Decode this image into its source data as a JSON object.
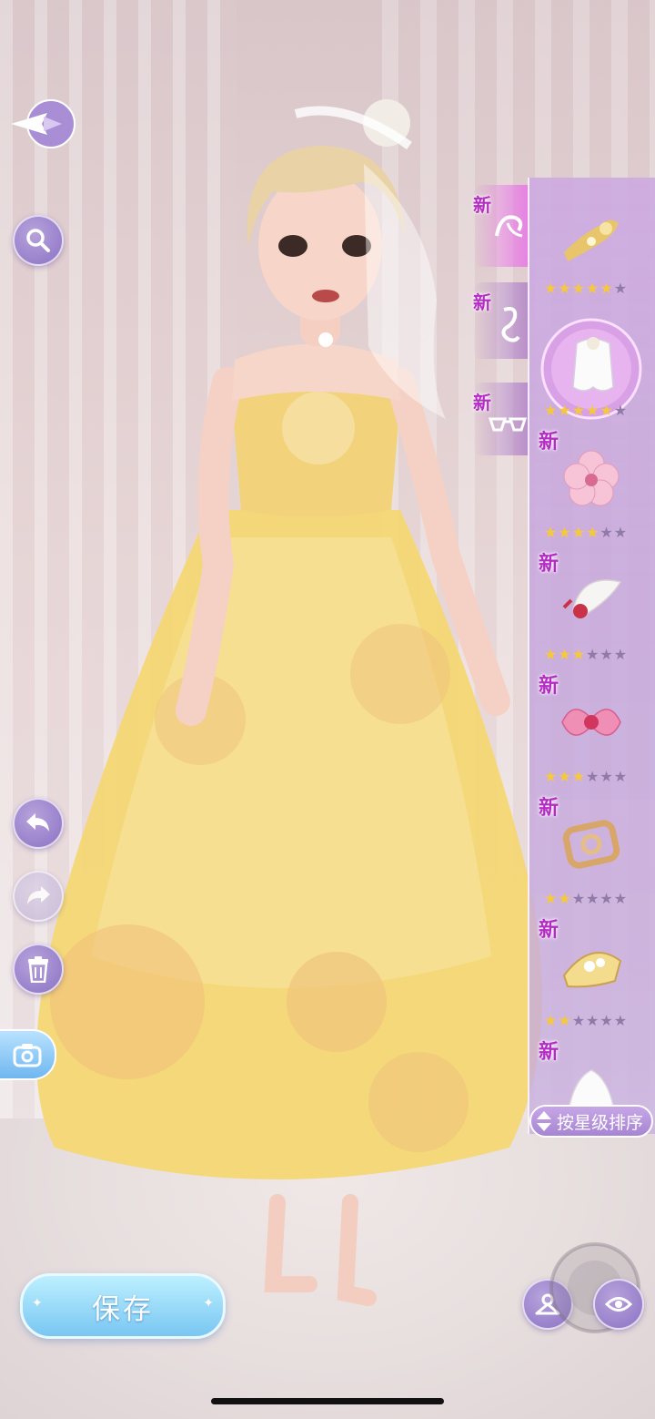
{
  "left_toolbar": {
    "back": "back-icon",
    "search": "search-icon",
    "undo": "undo-icon",
    "redo": "redo-icon",
    "delete": "trash-icon",
    "camera": "camera-icon"
  },
  "save_button": {
    "label": "保存"
  },
  "category_tabs": [
    {
      "new_label": "新",
      "icon": "hair-accessory-icon",
      "active": true
    },
    {
      "new_label": "新",
      "icon": "earring-icon",
      "active": false
    },
    {
      "new_label": "新",
      "icon": "glasses-icon",
      "active": false
    }
  ],
  "items": [
    {
      "new_label": "",
      "name_icon": "gold-hairpin",
      "stars": 5,
      "max_stars": 6,
      "selected": false
    },
    {
      "new_label": "",
      "name_icon": "white-veil",
      "stars": 5,
      "max_stars": 6,
      "selected": true
    },
    {
      "new_label": "新",
      "name_icon": "pink-flower",
      "stars": 4,
      "max_stars": 6,
      "selected": false
    },
    {
      "new_label": "新",
      "name_icon": "white-feather-clip",
      "stars": 3,
      "max_stars": 6,
      "selected": false
    },
    {
      "new_label": "新",
      "name_icon": "pink-bow",
      "stars": 3,
      "max_stars": 6,
      "selected": false
    },
    {
      "new_label": "新",
      "name_icon": "gold-ornament",
      "stars": 2,
      "max_stars": 6,
      "selected": false
    },
    {
      "new_label": "新",
      "name_icon": "gold-fan-clip",
      "stars": 2,
      "max_stars": 6,
      "selected": false
    },
    {
      "new_label": "新",
      "name_icon": "white-wing-clip",
      "stars": 0,
      "max_stars": 6,
      "selected": false
    }
  ],
  "sort_button": {
    "label": "按星级排序",
    "icon": "sort-arrows-icon"
  },
  "bottom_right": {
    "wardrobe": "hanger-icon",
    "view": "eye-icon"
  },
  "colors": {
    "accent_purple": "#a785d3",
    "save_blue": "#78c6f2",
    "star_gold": "#f6c93a",
    "new_magenta": "#b42cc4"
  }
}
